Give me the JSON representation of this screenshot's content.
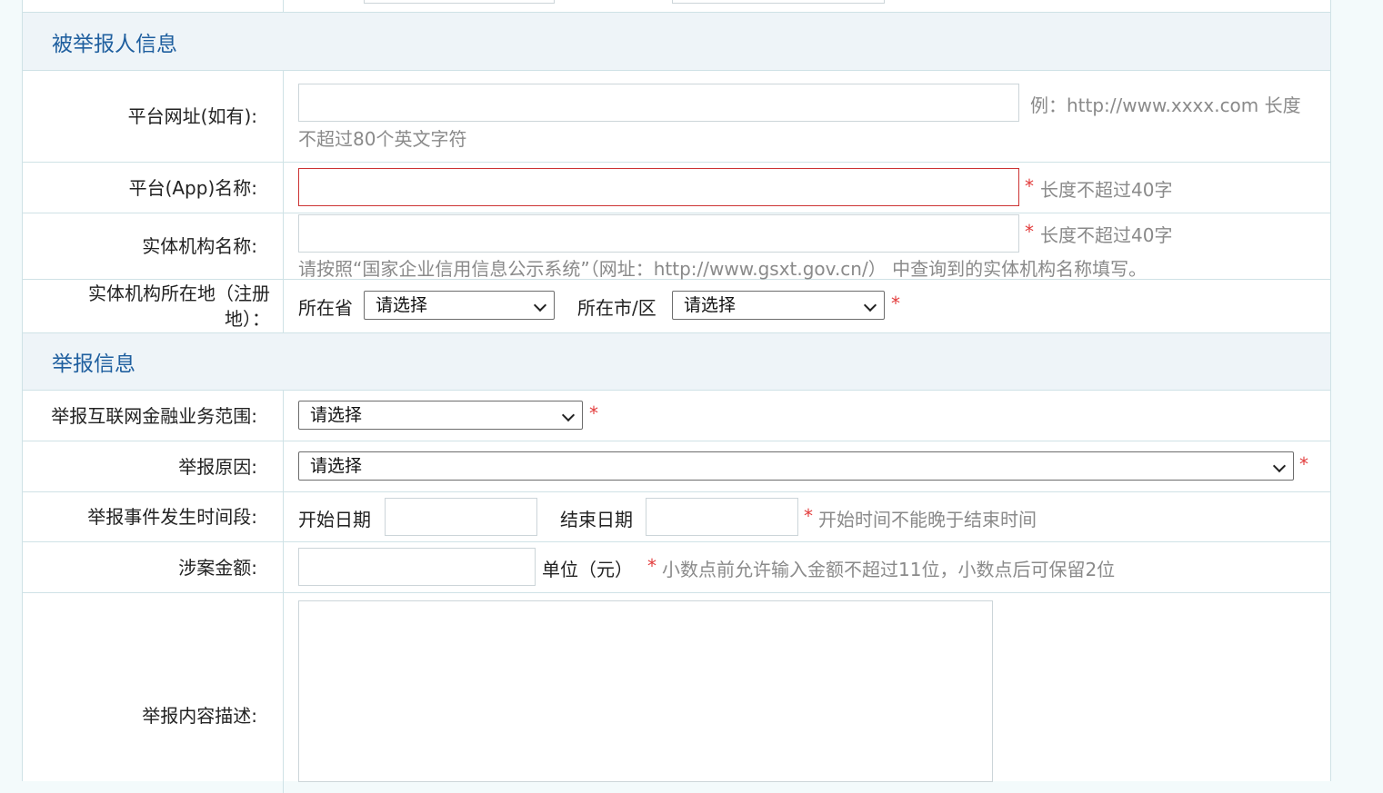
{
  "section_reported": {
    "title": "被举报人信息"
  },
  "platform_url": {
    "label": "平台网址(如有):",
    "value": "",
    "hint_line1": "例：http://www.xxxx.com 长度",
    "hint_line2": "不超过80个英文字符"
  },
  "app_name": {
    "label": "平台(App)名称:",
    "value": "",
    "required": "*",
    "hint": "长度不超过40字"
  },
  "entity_name": {
    "label": "实体机构名称:",
    "value": "",
    "required": "*",
    "hint": "长度不超过40字",
    "note": "请按照“国家企业信用信息公示系统”（网址：http://www.gsxt.gov.cn/） 中查询到的实体机构名称填写。"
  },
  "entity_location": {
    "label": "实体机构所在地（注册地）：",
    "province_label": "所在省",
    "province_value": "请选择",
    "city_label": "所在市/区",
    "city_value": "请选择",
    "required": "*"
  },
  "section_report": {
    "title": "举报信息"
  },
  "scope": {
    "label": "举报互联网金融业务范围:",
    "value": "请选择",
    "required": "*"
  },
  "reason": {
    "label": "举报原因:",
    "value": "请选择",
    "required": "*"
  },
  "period": {
    "label": "举报事件发生时间段:",
    "start_label": "开始日期",
    "start_value": "",
    "end_label": "结束日期",
    "end_value": "",
    "required": "*",
    "hint": "开始时间不能晚于结束时间"
  },
  "amount": {
    "label": "涉案金额:",
    "value": "",
    "unit": "单位（元）",
    "required": "*",
    "hint": "小数点前允许输入金额不超过11位，小数点后可保留2位"
  },
  "description": {
    "label": "举报内容描述:",
    "value": ""
  }
}
